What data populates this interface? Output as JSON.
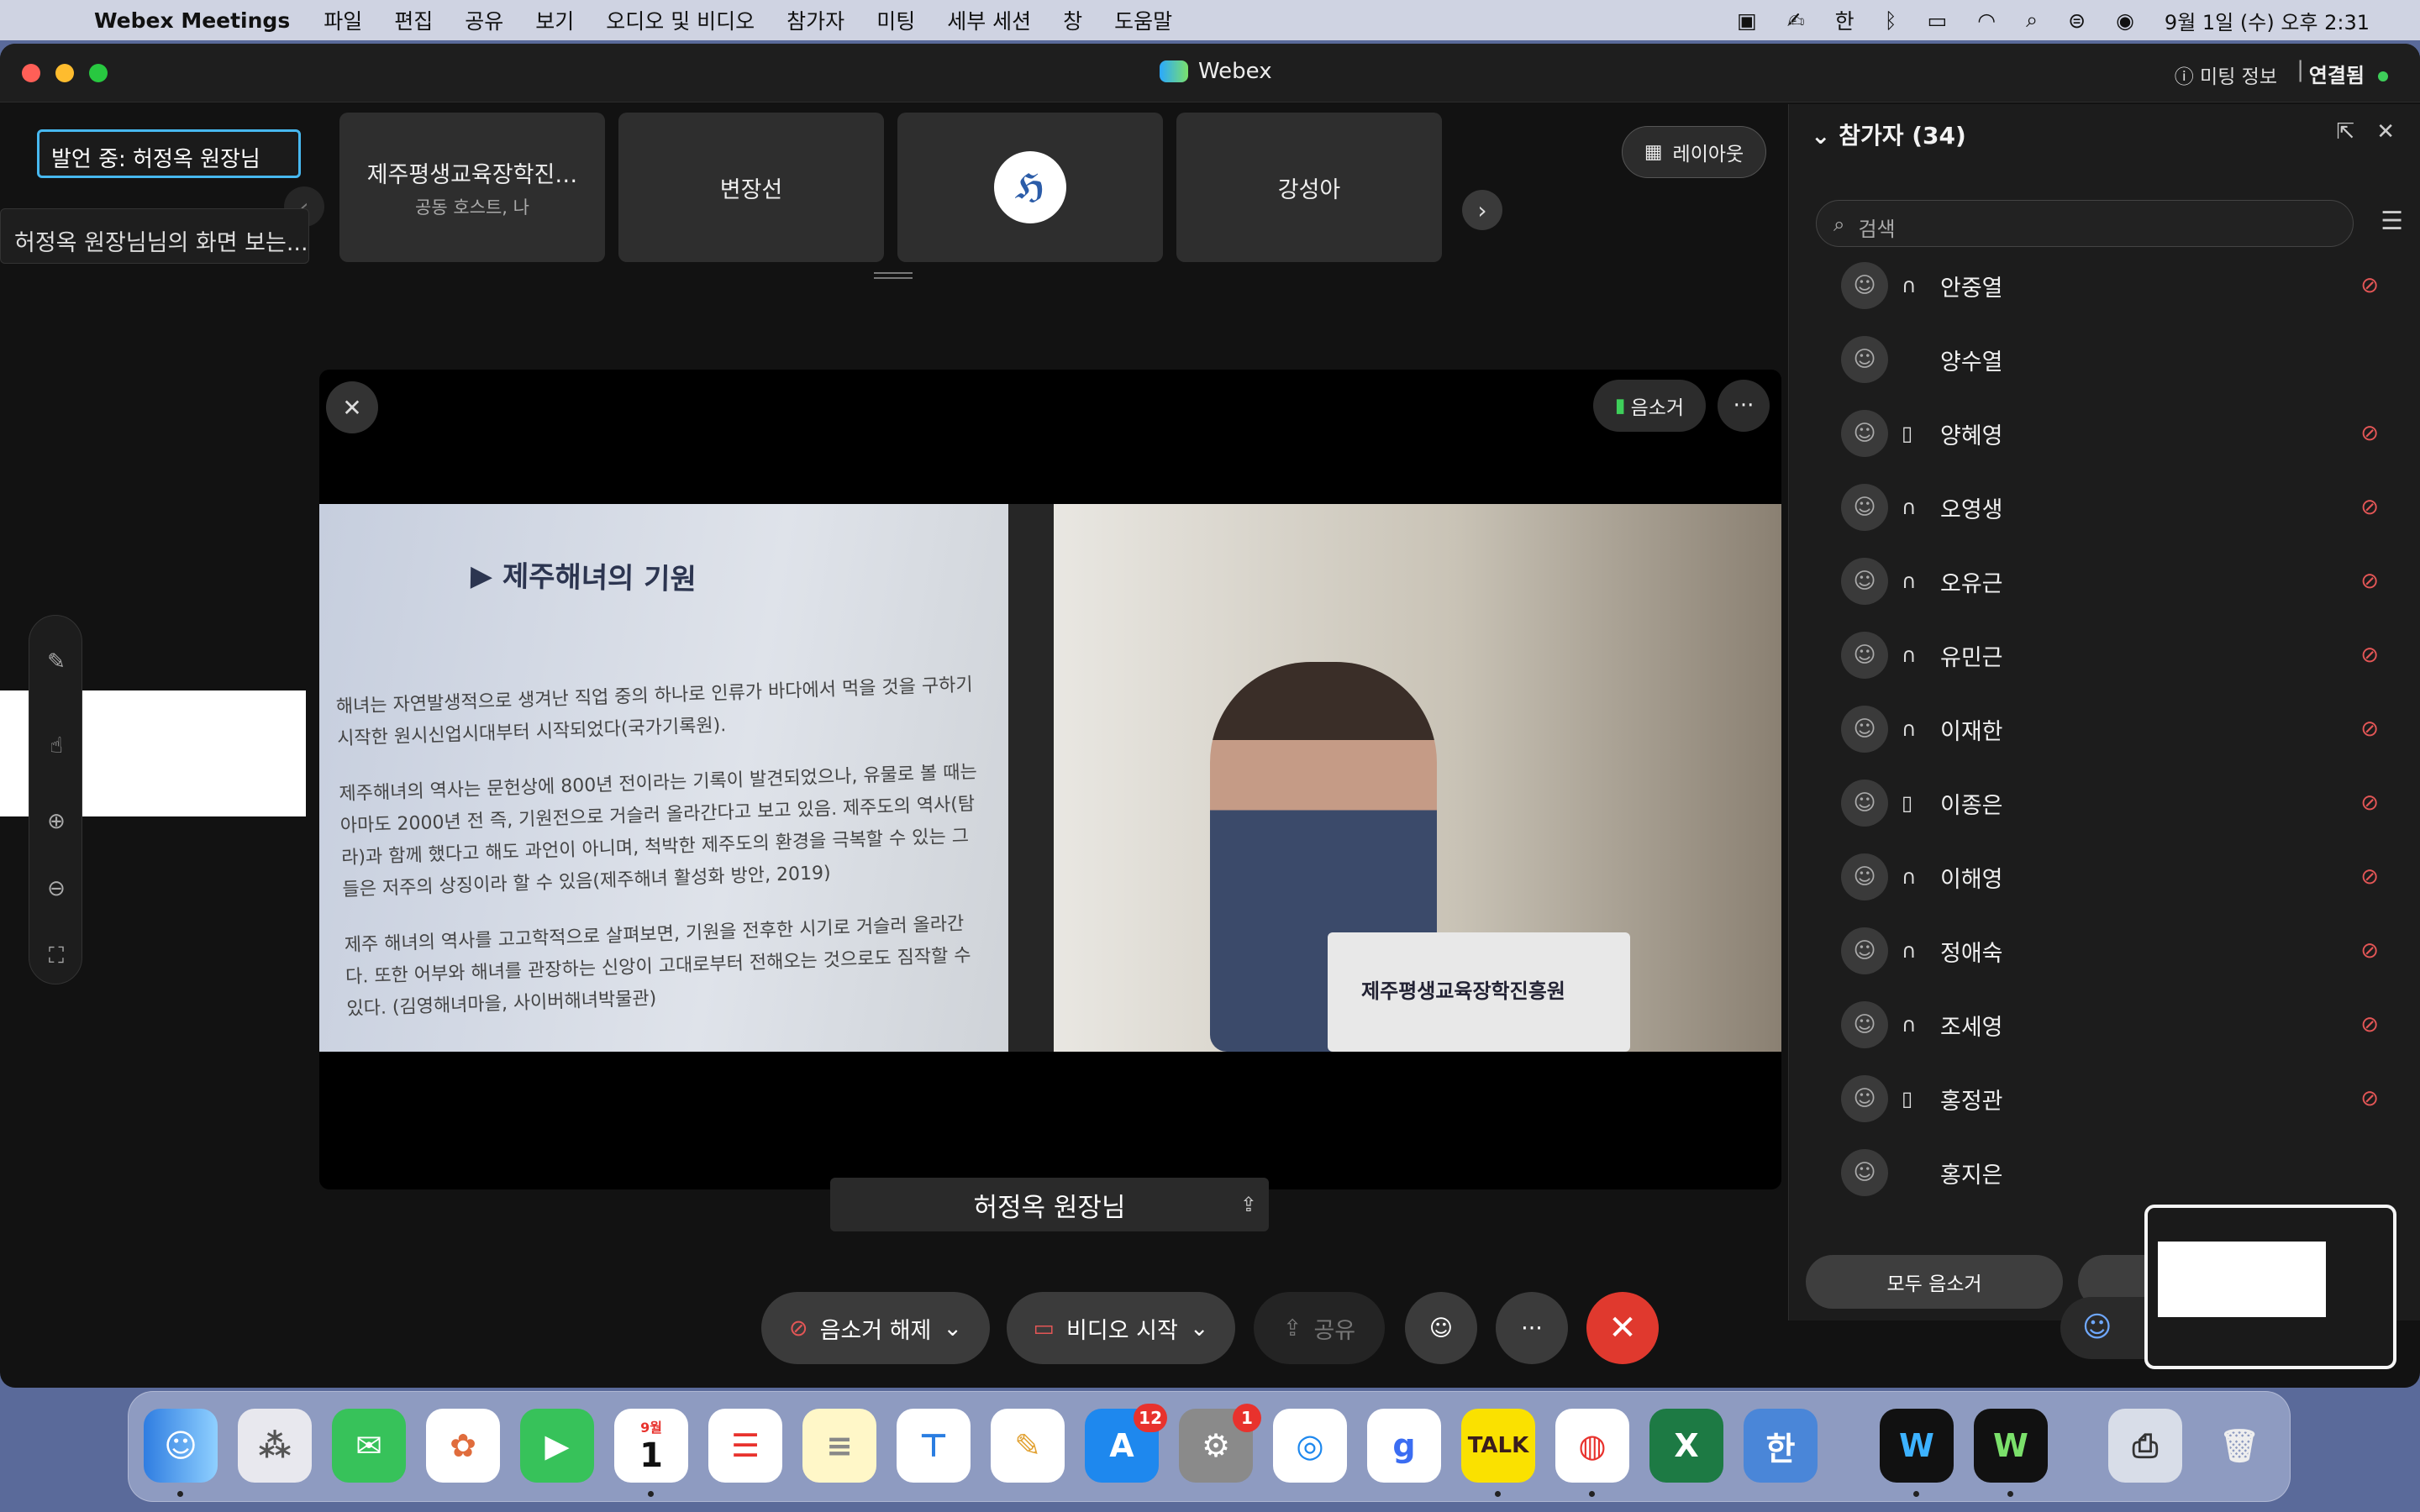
{
  "menubar": {
    "app": "Webex Meetings",
    "items": [
      "파일",
      "편집",
      "공유",
      "보기",
      "오디오 및 비디오",
      "참가자",
      "미팅",
      "세부 세션",
      "창",
      "도움말"
    ],
    "ime": "한",
    "datetime": "9월 1일 (수) 오후 2:31"
  },
  "window": {
    "title": "Webex",
    "meeting_info": "미팅 정보",
    "connected": "연결됨"
  },
  "speaking": "발언 중:  허정옥 원장님",
  "thumbnails": [
    {
      "name": "제주평생교육장학진…",
      "sub": "공동 호스트, 나"
    },
    {
      "name": "변장선",
      "sub": ""
    },
    {
      "name": "",
      "sub": ""
    },
    {
      "name": "강성아",
      "sub": ""
    }
  ],
  "layout_label": "레이아웃",
  "viewing": "허정옥 원장님님의 화면 보는...",
  "stage": {
    "mute_badge": "음소거",
    "presenter": "허정옥 원장님"
  },
  "video": {
    "slide_title": "제주해녀의 기원",
    "slide_lines": [
      "해녀는 자연발생적으로 생겨난 직업 중의 하나로 인류가 바다에서 먹을 것을 구하기 시작한 원시신업시대부터 시작되었다(국가기록원).",
      "제주해녀의 역사는 문헌상에 800년 전이라는 기록이 발견되었으나, 유물로 볼 때는 아마도 2000년 전 즉, 기원전으로 거슬러 올라간다고 보고 있음. 제주도의 역사(탐라)과 함께 했다고 해도 과언이 아니며, 척박한 제주도의 환경을 극복할 수 있는 그들은 저주의 상징이라 할 수 있음(제주해녀 활성화 방안, 2019)",
      "제주 해녀의 역사를 고고학적으로 살펴보면, 기원을 전후한 시기로 거슬러 올라간다. 또한 어부와 해녀를 관장하는 신앙이 고대로부터 전해오는 것으로도 짐작할 수 있다. (김영해녀마을, 사이버해녀박물관)"
    ],
    "podium_text": "제주평생교육장학진흥원"
  },
  "panel": {
    "title": "참가자 (34)",
    "search_placeholder": "검색",
    "participants": [
      {
        "name": "안중열",
        "device": "headset",
        "muted": true
      },
      {
        "name": "양수열",
        "device": "",
        "muted": false
      },
      {
        "name": "양혜영",
        "device": "phone",
        "muted": true
      },
      {
        "name": "오영생",
        "device": "headset",
        "muted": true
      },
      {
        "name": "오유근",
        "device": "headset",
        "muted": true
      },
      {
        "name": "유민근",
        "device": "headset",
        "muted": true
      },
      {
        "name": "이재한",
        "device": "headset",
        "muted": true
      },
      {
        "name": "이종은",
        "device": "phone",
        "muted": true
      },
      {
        "name": "이해영",
        "device": "headset",
        "muted": true
      },
      {
        "name": "정애숙",
        "device": "headset",
        "muted": true
      },
      {
        "name": "조세영",
        "device": "headset",
        "muted": true
      },
      {
        "name": "홍정관",
        "device": "phone",
        "muted": true
      },
      {
        "name": "홍지은",
        "device": "",
        "muted": false
      }
    ],
    "mute_all": "모두 음소거"
  },
  "controls": {
    "unmute": "음소거 해제",
    "video": "비디오 시작",
    "share": "공유"
  },
  "dock": {
    "calendar_month": "9월",
    "calendar_day": "1",
    "appstore_badge": "12",
    "settings_badge": "1",
    "kakao": "TALK"
  },
  "colors": {
    "accent": "#47b8f0",
    "end": "#e0392e",
    "muted": "#e35656"
  }
}
